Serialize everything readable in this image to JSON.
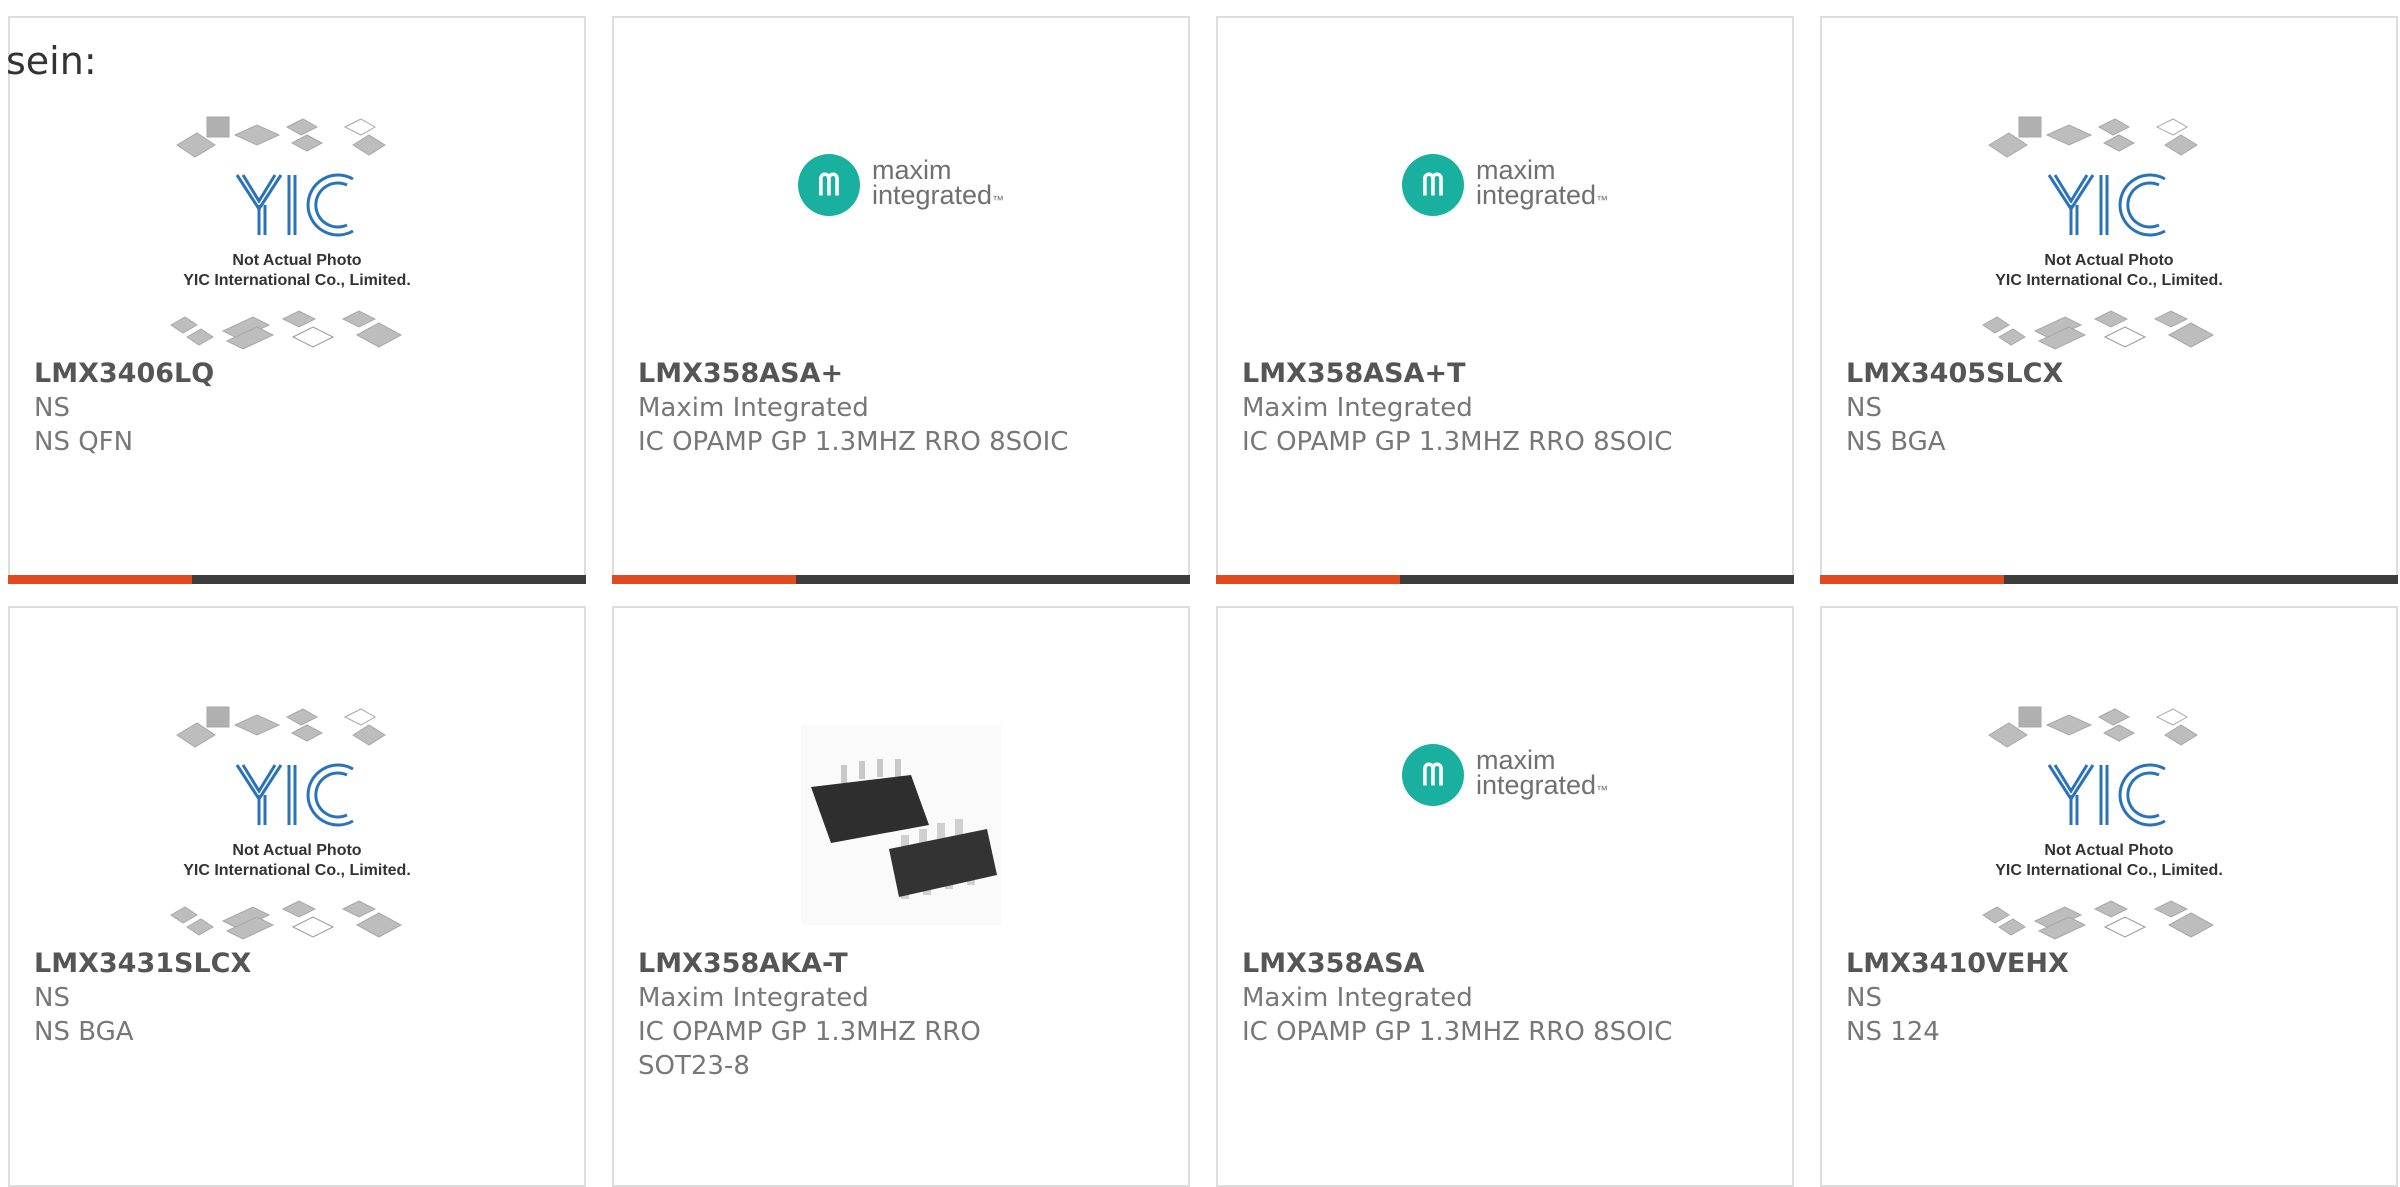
{
  "prefix_text": "sein:",
  "colors": {
    "accent": "#e04a1e",
    "bar_dark": "#3d3d3d",
    "yic_blue": "#2a73b8",
    "maxim_teal": "#19b0a0"
  },
  "products": [
    {
      "part_number": "LMX3406LQ",
      "manufacturer": "NS",
      "description": "NS QFN",
      "image": "yic-not-actual-photo",
      "image_caption_1": "Not Actual Photo",
      "image_caption_2": "YIC International Co., Limited.",
      "has_bar": true
    },
    {
      "part_number": "LMX358ASA+",
      "manufacturer": "Maxim Integrated",
      "description": "IC OPAMP GP 1.3MHZ RRO 8SOIC",
      "image": "maxim-logo",
      "has_bar": true
    },
    {
      "part_number": "LMX358ASA+T",
      "manufacturer": "Maxim Integrated",
      "description": "IC OPAMP GP 1.3MHZ RRO 8SOIC",
      "image": "maxim-logo",
      "has_bar": true
    },
    {
      "part_number": "LMX3405SLCX",
      "manufacturer": "NS",
      "description": "NS BGA",
      "image": "yic-not-actual-photo",
      "image_caption_1": "Not Actual Photo",
      "image_caption_2": "YIC International Co., Limited.",
      "has_bar": true
    },
    {
      "part_number": "LMX3431SLCX",
      "manufacturer": "NS",
      "description": "NS BGA",
      "image": "yic-not-actual-photo",
      "image_caption_1": "Not Actual Photo",
      "image_caption_2": "YIC International Co., Limited.",
      "has_bar": false
    },
    {
      "part_number": "LMX358AKA-T",
      "manufacturer": "Maxim Integrated",
      "description": "IC OPAMP GP 1.3MHZ RRO SOT23-8",
      "image": "sot23-chip-photo",
      "has_bar": false
    },
    {
      "part_number": "LMX358ASA",
      "manufacturer": "Maxim Integrated",
      "description": "IC OPAMP GP 1.3MHZ RRO 8SOIC",
      "image": "maxim-logo",
      "has_bar": false
    },
    {
      "part_number": "LMX3410VEHX",
      "manufacturer": "NS",
      "description": "NS 124",
      "image": "yic-not-actual-photo",
      "image_caption_1": "Not Actual Photo",
      "image_caption_2": "YIC International Co., Limited.",
      "has_bar": false
    }
  ],
  "maxim_logo": {
    "line1": "maxim",
    "line2": "integrated",
    "mark": "™"
  }
}
